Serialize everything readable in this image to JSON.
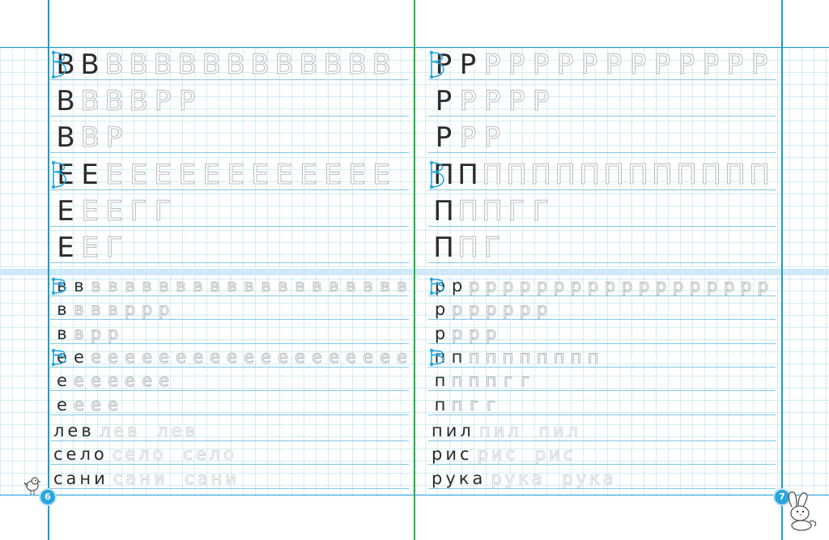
{
  "page_left": {
    "page_number": "6",
    "big_rows": [
      {
        "letter": "В",
        "solid_count": 2,
        "trace": [
          "В",
          "В",
          "В",
          "В",
          "В",
          "В",
          "В",
          "В",
          "В",
          "В",
          "В",
          "В"
        ]
      },
      {
        "letter": "В",
        "solid_count": 1,
        "trace": [
          "В",
          "В",
          "В",
          "Р",
          "Р"
        ]
      },
      {
        "letter": "В",
        "solid_count": 1,
        "trace": [
          "В",
          "Р"
        ]
      },
      {
        "letter": "Е",
        "solid_count": 2,
        "trace": [
          "Е",
          "Е",
          "Е",
          "Е",
          "Е",
          "Е",
          "Е",
          "Е",
          "Е",
          "Е",
          "Е",
          "Е"
        ]
      },
      {
        "letter": "Е",
        "solid_count": 1,
        "trace": [
          "Е",
          "Е",
          "Г",
          "Г"
        ]
      },
      {
        "letter": "Е",
        "solid_count": 1,
        "trace": [
          "Е",
          "Г"
        ]
      }
    ],
    "small_rows": [
      {
        "letter": "в",
        "solid_count": 2,
        "trace": [
          "в",
          "в",
          "в",
          "в",
          "в",
          "в",
          "в",
          "в",
          "в",
          "в",
          "в",
          "в",
          "в",
          "в",
          "в",
          "в",
          "в",
          "в",
          "в",
          "в"
        ]
      },
      {
        "letter": "в",
        "solid_count": 1,
        "trace": [
          "в",
          "в",
          "в",
          "р",
          "р",
          "р"
        ]
      },
      {
        "letter": "в",
        "solid_count": 1,
        "trace": [
          "в",
          "р",
          "р"
        ]
      },
      {
        "letter": "е",
        "solid_count": 2,
        "trace": [
          "е",
          "е",
          "е",
          "е",
          "е",
          "е",
          "е",
          "е",
          "е",
          "е",
          "е",
          "е",
          "е",
          "е",
          "е",
          "е",
          "е",
          "е",
          "е",
          "е"
        ]
      },
      {
        "letter": "е",
        "solid_count": 1,
        "trace": [
          "е",
          "е",
          "е",
          "е",
          "е",
          "е"
        ]
      },
      {
        "letter": "е",
        "solid_count": 1,
        "trace": [
          "е",
          "е",
          "е"
        ]
      }
    ],
    "words": [
      {
        "solid": "лев",
        "trace": "лев лев"
      },
      {
        "solid": "село",
        "trace": "село село"
      },
      {
        "solid": "сани",
        "trace": "сани сани"
      }
    ]
  },
  "page_right": {
    "page_number": "7",
    "big_rows": [
      {
        "letter": "Р",
        "solid_count": 2,
        "trace": [
          "Р",
          "Р",
          "Р",
          "Р",
          "Р",
          "Р",
          "Р",
          "Р",
          "Р",
          "Р",
          "Р",
          "Р"
        ]
      },
      {
        "letter": "Р",
        "solid_count": 1,
        "trace": [
          "Р",
          "Р",
          "Р",
          "Р"
        ]
      },
      {
        "letter": "Р",
        "solid_count": 1,
        "trace": [
          "Р",
          "Р"
        ]
      },
      {
        "letter": "П",
        "solid_count": 2,
        "trace": [
          "П",
          "П",
          "П",
          "П",
          "П",
          "П",
          "П",
          "П",
          "П",
          "П",
          "П",
          "П"
        ]
      },
      {
        "letter": "П",
        "solid_count": 1,
        "trace": [
          "П",
          "П",
          "Г",
          "Г"
        ]
      },
      {
        "letter": "П",
        "solid_count": 1,
        "trace": [
          "П",
          "Г"
        ]
      }
    ],
    "small_rows": [
      {
        "letter": "р",
        "solid_count": 2,
        "trace": [
          "р",
          "р",
          "р",
          "р",
          "р",
          "р",
          "р",
          "р",
          "р",
          "р",
          "р",
          "р",
          "р",
          "р",
          "р",
          "р",
          "р",
          "р",
          "р",
          "р"
        ]
      },
      {
        "letter": "р",
        "solid_count": 1,
        "trace": [
          "р",
          "р",
          "р",
          "р",
          "р",
          "р"
        ]
      },
      {
        "letter": "р",
        "solid_count": 1,
        "trace": [
          "р",
          "р",
          "р"
        ]
      },
      {
        "letter": "п",
        "solid_count": 2,
        "trace": [
          "п",
          "п",
          "п",
          "п",
          "п",
          "п",
          "п",
          "п"
        ]
      },
      {
        "letter": "п",
        "solid_count": 1,
        "trace": [
          "п",
          "п",
          "п",
          "г",
          "г"
        ]
      },
      {
        "letter": "п",
        "solid_count": 1,
        "trace": [
          "п",
          "г",
          "г"
        ]
      }
    ],
    "words": [
      {
        "solid": "пил",
        "trace": "пил пил"
      },
      {
        "solid": "рис",
        "trace": "рис рис"
      },
      {
        "solid": "рука",
        "trace": "рука рука"
      }
    ]
  },
  "colors": {
    "margin_line": "#1a9ad6",
    "spine": "#2bb24c",
    "grid": "#9fd3f0",
    "guide": "#2aa6de",
    "ink": "#2b2b2b",
    "trace": "#b8bcc0"
  },
  "icons": {
    "left_corner": "bird-icon",
    "right_corner": "bunny-icon",
    "stroke_guide": "stroke-order-arrow-icon"
  }
}
